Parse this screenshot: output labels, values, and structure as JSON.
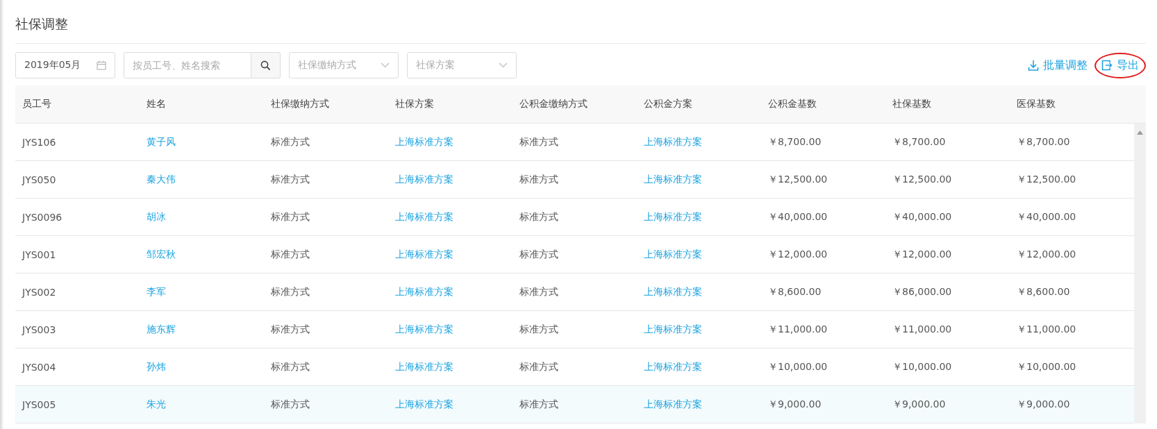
{
  "page_title": "社保调整",
  "filters": {
    "month": "2019年05月",
    "search": {
      "placeholder": "按员工号、姓名搜索"
    },
    "selects": [
      {
        "placeholder": "社保缴纳方式"
      },
      {
        "placeholder": "社保方案"
      }
    ]
  },
  "actions": [
    {
      "kind": "download",
      "label": "批量调整",
      "highlighted": false
    },
    {
      "kind": "export",
      "label": "导出",
      "highlighted": true
    }
  ],
  "table": {
    "columns": [
      "员工号",
      "姓名",
      "社保缴纳方式",
      "社保方案",
      "公积金缴纳方式",
      "公积金方案",
      "公积金基数",
      "社保基数",
      "医保基数"
    ],
    "rows": [
      {
        "selected": false,
        "cells": [
          "JYS106",
          "黄子风",
          "标准方式",
          "上海标准方案",
          "标准方式",
          "上海标准方案",
          "￥8,700.00",
          "￥8,700.00",
          "￥8,700.00"
        ]
      },
      {
        "selected": false,
        "cells": [
          "JYS050",
          "秦大伟",
          "标准方式",
          "上海标准方案",
          "标准方式",
          "上海标准方案",
          "￥12,500.00",
          "￥12,500.00",
          "￥12,500.00"
        ]
      },
      {
        "selected": false,
        "cells": [
          "JYS0096",
          "胡冰",
          "标准方式",
          "上海标准方案",
          "标准方式",
          "上海标准方案",
          "￥40,000.00",
          "￥40,000.00",
          "￥40,000.00"
        ]
      },
      {
        "selected": false,
        "cells": [
          "JYS001",
          "邹宏秋",
          "标准方式",
          "上海标准方案",
          "标准方式",
          "上海标准方案",
          "￥12,000.00",
          "￥12,000.00",
          "￥12,000.00"
        ]
      },
      {
        "selected": false,
        "cells": [
          "JYS002",
          "李军",
          "标准方式",
          "上海标准方案",
          "标准方式",
          "上海标准方案",
          "￥8,600.00",
          "￥86,000.00",
          "￥8,600.00"
        ]
      },
      {
        "selected": false,
        "cells": [
          "JYS003",
          "施东辉",
          "标准方式",
          "上海标准方案",
          "标准方式",
          "上海标准方案",
          "￥11,000.00",
          "￥11,000.00",
          "￥11,000.00"
        ]
      },
      {
        "selected": false,
        "cells": [
          "JYS004",
          "孙炜",
          "标准方式",
          "上海标准方案",
          "标准方式",
          "上海标准方案",
          "￥10,000.00",
          "￥10,000.00",
          "￥10,000.00"
        ]
      },
      {
        "selected": true,
        "cells": [
          "JYS005",
          "朱光",
          "标准方式",
          "上海标准方案",
          "标准方式",
          "上海标准方案",
          "￥9,000.00",
          "￥9,000.00",
          "￥9,000.00"
        ]
      }
    ]
  }
}
